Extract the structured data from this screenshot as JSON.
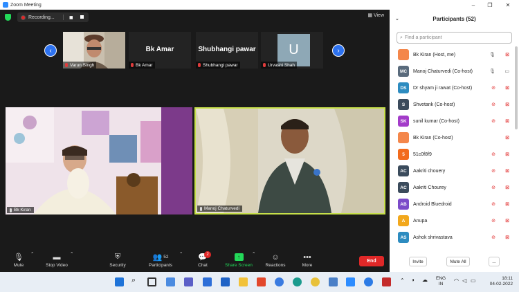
{
  "window": {
    "title": "Zoom Meeting",
    "minimize": "–",
    "maximize": "❐",
    "close": "✕"
  },
  "topbar": {
    "recording_label": "Recording...",
    "view_label": "View"
  },
  "strip": {
    "prev_arrow": "‹",
    "next_arrow": "›",
    "tiles": [
      {
        "name": "Varun Singh"
      },
      {
        "name": "Bk Amar",
        "big": "Bk Amar"
      },
      {
        "name": "Shubhangi pawar",
        "big": "Shubhangi pawar"
      },
      {
        "name": "Urvashi Shah",
        "avatar": "U"
      }
    ]
  },
  "videos": [
    {
      "name": "Bk Kiran"
    },
    {
      "name": "Manoj Chaturvedi"
    }
  ],
  "toolbar": {
    "mute": "Mute",
    "stop_video": "Stop Video",
    "security": "Security",
    "participants": "Participants",
    "participants_count": "52",
    "chat": "Chat",
    "chat_badge": "2",
    "share_screen": "Share Screen",
    "reactions": "Reactions",
    "more": "More",
    "end": "End",
    "accent_green": "#23d959",
    "end_color": "#e02828"
  },
  "panel": {
    "title": "Participants (52)",
    "search_placeholder": "Find a participant",
    "participants": [
      {
        "initials": "",
        "name": "Bk Kiran (Host, me)",
        "color": "#f4874b",
        "mic": "on",
        "cam": "off"
      },
      {
        "initials": "MC",
        "name": "Manoj Chaturvedi (Co-host)",
        "color": "#5a6b7c",
        "mic": "on",
        "cam": "on"
      },
      {
        "initials": "DS",
        "name": "Dr shyam ji rawat (Co-host)",
        "color": "#2d8cc0",
        "mic": "off",
        "cam": "off"
      },
      {
        "initials": "S",
        "name": "Shvetank (Co-host)",
        "color": "#3b4b5c",
        "mic": "off",
        "cam": "off"
      },
      {
        "initials": "SK",
        "name": "sunil kumar (Co-host)",
        "color": "#a33cc9",
        "mic": "off",
        "cam": "off"
      },
      {
        "initials": "",
        "name": "Bk Kiran (Co-host)",
        "color": "#f4874b",
        "mic": "",
        "cam": "off"
      },
      {
        "initials": "5",
        "name": "51c0f8f9",
        "color": "#f26b1d",
        "mic": "off",
        "cam": "off"
      },
      {
        "initials": "AC",
        "name": "Aakriti chouery",
        "color": "#3b4b5c",
        "mic": "off",
        "cam": "off"
      },
      {
        "initials": "AC",
        "name": "Aakriti Chourey",
        "color": "#3b4b5c",
        "mic": "off",
        "cam": "off"
      },
      {
        "initials": "AB",
        "name": "Android Bluedroid",
        "color": "#7b4bc9",
        "mic": "off",
        "cam": "off"
      },
      {
        "initials": "A",
        "name": "Anupa",
        "color": "#f2a81d",
        "mic": "off",
        "cam": "off"
      },
      {
        "initials": "AS",
        "name": "Ashok shrivastava",
        "color": "#2d8cc0",
        "mic": "off",
        "cam": "off"
      }
    ],
    "invite": "Invite",
    "mute_all": "Mute All",
    "more": "..."
  },
  "taskbar": {
    "lang_top": "ENG",
    "lang_bottom": "IN",
    "time": "18:11",
    "date": "04-02-2022"
  }
}
